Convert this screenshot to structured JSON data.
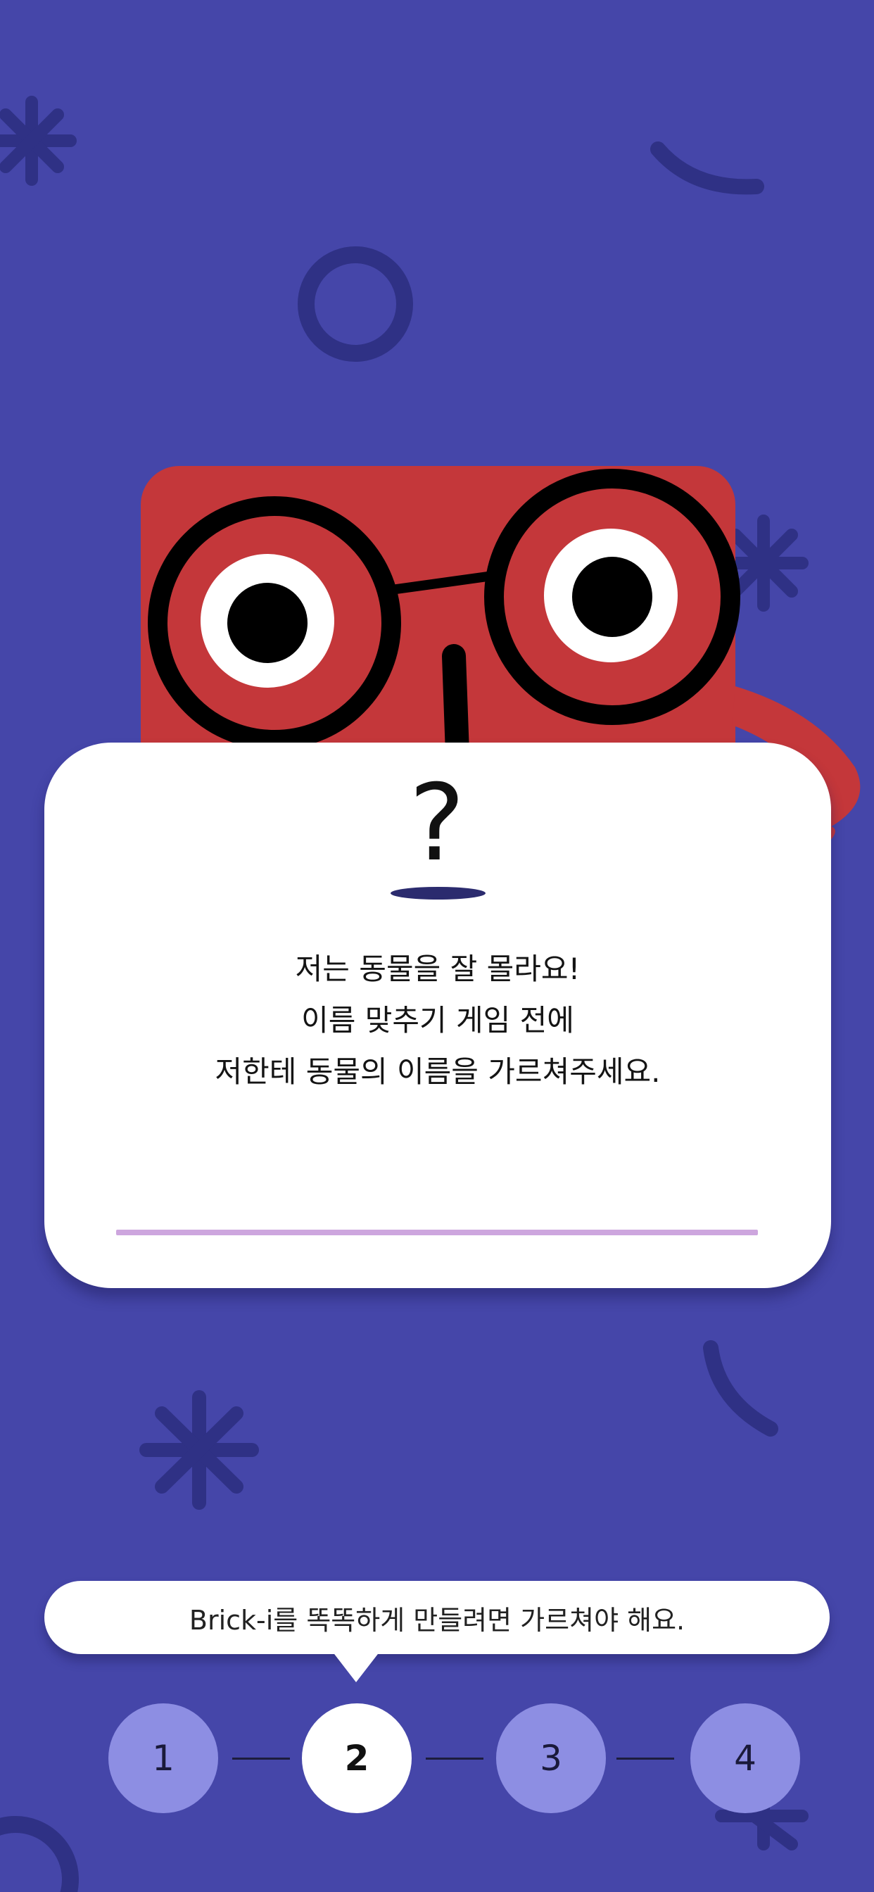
{
  "colors": {
    "background": "#4546a9",
    "decoration": "#2f3185",
    "character_body": "#c4373a",
    "card": "#ffffff",
    "progress_bar": "#cda6de",
    "step_inactive": "#8d8ee3",
    "step_active": "#ffffff"
  },
  "card": {
    "question_mark": "?",
    "message_lines": [
      "저는 동물을 잘 몰라요!",
      "이름 맞추기 게임 전에",
      "저한테 동물의 이름을 가르쳐주세요."
    ]
  },
  "hint": {
    "text": "Brick-i를 똑똑하게 만들려면 가르쳐야 해요."
  },
  "steps": [
    {
      "label": "1",
      "active": false
    },
    {
      "label": "2",
      "active": true
    },
    {
      "label": "3",
      "active": false
    },
    {
      "label": "4",
      "active": false
    }
  ],
  "icons": [
    "asterisk-icon",
    "ring-icon",
    "arc-icon",
    "character-mascot"
  ]
}
